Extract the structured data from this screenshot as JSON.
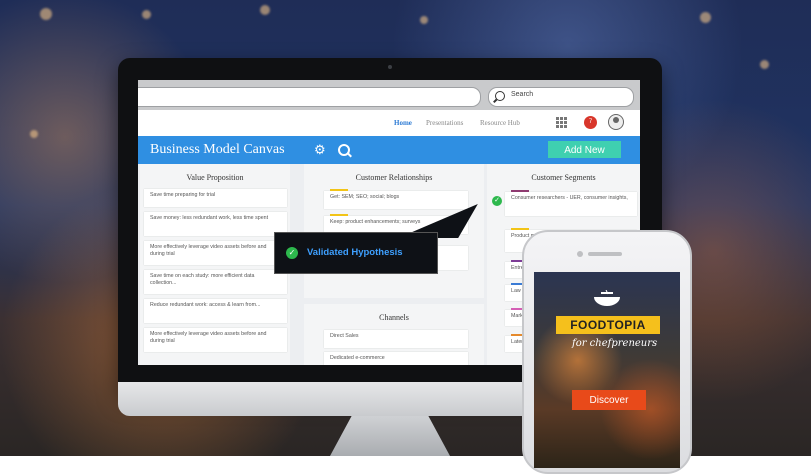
{
  "browser": {
    "search_placeholder": "Search",
    "nav": [
      "Home",
      "Presentations",
      "Resource Hub"
    ],
    "notification_count": "7"
  },
  "app": {
    "title": "Business Model Canvas",
    "add_new": "Add New"
  },
  "columns": {
    "value_proposition": {
      "title": "Value Proposition",
      "cards": [
        "Save time preparing for trial",
        "Save money: less redundant work, less time spent",
        "More effectively leverage video assets before and during trial",
        "Save time on each study: more efficient data collection...",
        "Reduce redundant work: access & learn from...",
        "More effectively leverage video assets before and during trial"
      ]
    },
    "customer_relationships": {
      "title": "Customer Relationships",
      "cards": [
        "Get: SEM; SEO; social; blogs",
        "Keep: product enhancements; surveys"
      ]
    },
    "channels": {
      "title": "Channels",
      "cards": [
        "Direct Sales",
        "Dedicated e-commerce"
      ]
    },
    "customer_segments": {
      "title": "Customer Segments",
      "cards": [
        "Consumer researchers - UER, consumer insights,",
        "Product manag",
        "Entrep",
        "Law F",
        "Marke",
        "Later"
      ]
    }
  },
  "tooltip": {
    "text": "Validated Hypothesis"
  },
  "phone": {
    "brand": "FOODTOPIA",
    "tagline": "for chefpreneurs",
    "cta": "Discover"
  },
  "colors": {
    "brand_blue": "#2f8fe2",
    "add_new": "#3fd0b0",
    "validated_green": "#2db84d",
    "foodtopia_yellow": "#f5c01c",
    "discover_orange": "#e84a1a"
  }
}
